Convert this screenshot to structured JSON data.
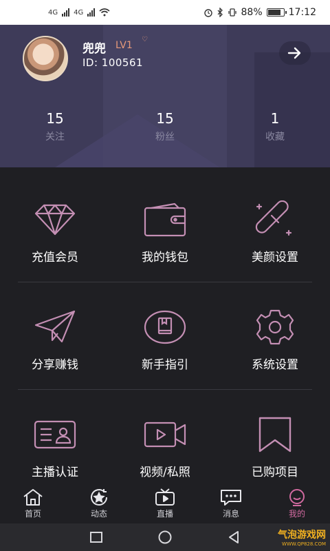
{
  "status_bar": {
    "network_1": "4G",
    "network_2": "4G",
    "battery_percent": "88%",
    "battery_level": 0.88,
    "time": "17:12"
  },
  "profile": {
    "name": "兜兜",
    "level": "LV1",
    "id_text": "ID: 100561",
    "stats": [
      {
        "value": "15",
        "label": "关注"
      },
      {
        "value": "15",
        "label": "粉丝"
      },
      {
        "value": "1",
        "label": "收藏"
      }
    ]
  },
  "menu": [
    {
      "label": "充值会员",
      "icon": "diamond-icon"
    },
    {
      "label": "我的钱包",
      "icon": "wallet-icon"
    },
    {
      "label": "美颜设置",
      "icon": "beauty-pen-icon"
    },
    {
      "label": "分享赚钱",
      "icon": "paper-plane-icon"
    },
    {
      "label": "新手指引",
      "icon": "guide-book-icon"
    },
    {
      "label": "系统设置",
      "icon": "gear-icon"
    },
    {
      "label": "主播认证",
      "icon": "id-card-icon"
    },
    {
      "label": "视频/私照",
      "icon": "video-camera-icon"
    },
    {
      "label": "已购项目",
      "icon": "bookmark-icon"
    }
  ],
  "tabs": [
    {
      "label": "首页",
      "icon": "home-icon"
    },
    {
      "label": "动态",
      "icon": "star-refresh-icon"
    },
    {
      "label": "直播",
      "icon": "tv-icon"
    },
    {
      "label": "消息",
      "icon": "chat-icon"
    },
    {
      "label": "我的",
      "icon": "profile-icon",
      "active": true
    }
  ],
  "colors": {
    "accent": "#d16aa0",
    "icon_stroke": "#c48fb4",
    "header_bg": "#3e3b59",
    "page_bg": "#1f1f23"
  },
  "watermark": {
    "text": "气泡游戏网",
    "sub": "WWW.QP828.COM"
  }
}
